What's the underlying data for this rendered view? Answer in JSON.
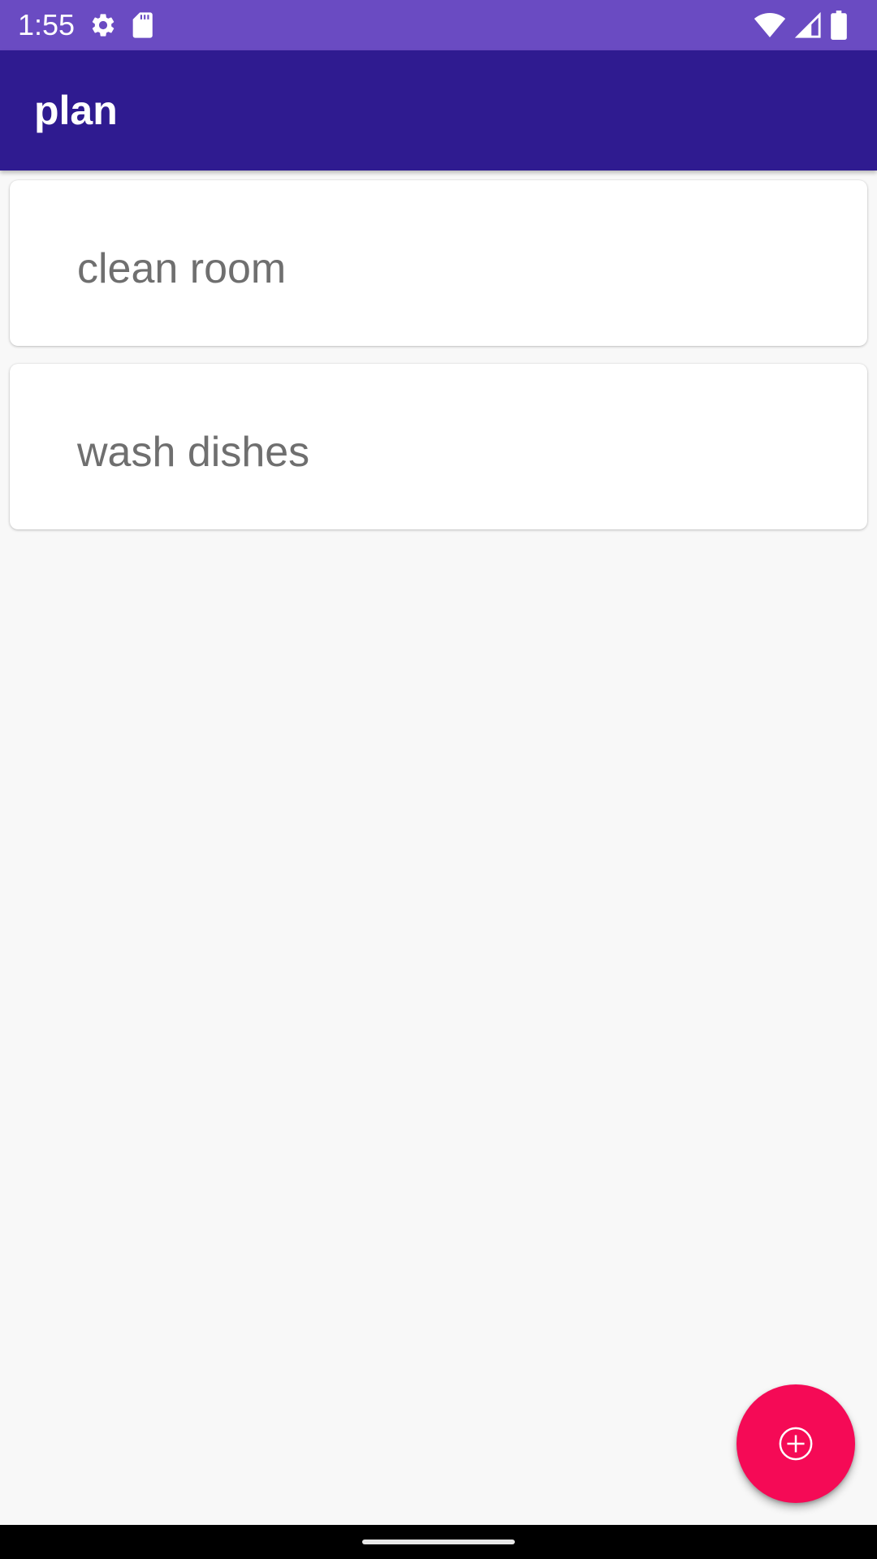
{
  "colors": {
    "status_bar": "#6a4bc2",
    "app_bar": "#2f1b90",
    "fab": "#f50a56",
    "background": "#f8f8f8"
  },
  "status_bar": {
    "time": "1:55",
    "left_icons": [
      "gear-icon",
      "sd-card-icon"
    ],
    "right_icons": [
      "wifi-icon",
      "signal-icon",
      "battery-icon"
    ]
  },
  "app_bar": {
    "title": "plan"
  },
  "tasks": [
    {
      "label": "clean room"
    },
    {
      "label": "wash dishes"
    }
  ],
  "fab": {
    "icon": "add-circle-icon"
  }
}
